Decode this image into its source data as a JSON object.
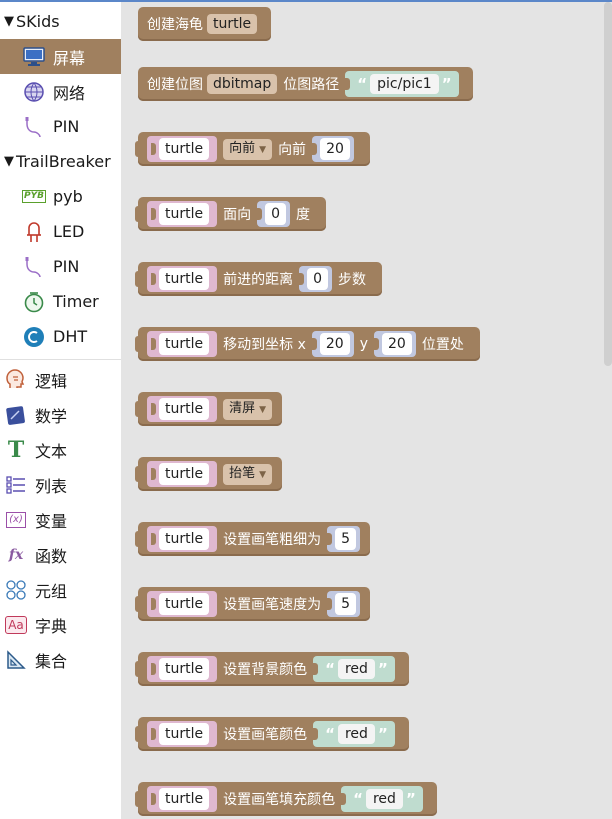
{
  "sidebar": {
    "groups": [
      {
        "label": "SKids",
        "items": [
          {
            "label": "屏幕",
            "icon": "monitor-icon",
            "selected": true
          },
          {
            "label": "网络",
            "icon": "network-icon"
          },
          {
            "label": "PIN",
            "icon": "pin-cable-icon"
          }
        ]
      },
      {
        "label": "TrailBreaker",
        "items": [
          {
            "label": "pyb",
            "icon": "pyb-icon",
            "icon_text": "PYB"
          },
          {
            "label": "LED",
            "icon": "led-icon"
          },
          {
            "label": "PIN",
            "icon": "pin-cable-icon"
          },
          {
            "label": "Timer",
            "icon": "clock-icon"
          },
          {
            "label": "DHT",
            "icon": "dht-icon"
          }
        ]
      }
    ],
    "categories": [
      {
        "label": "逻辑",
        "icon": "logic-head-icon"
      },
      {
        "label": "数学",
        "icon": "math-icon"
      },
      {
        "label": "文本",
        "icon": "text-icon",
        "icon_text": "T"
      },
      {
        "label": "列表",
        "icon": "list-icon"
      },
      {
        "label": "变量",
        "icon": "variable-icon",
        "icon_text": "(x)"
      },
      {
        "label": "函数",
        "icon": "function-icon",
        "icon_text": "fx"
      },
      {
        "label": "元组",
        "icon": "tuple-icon"
      },
      {
        "label": "字典",
        "icon": "dictionary-icon",
        "icon_text": "Aa"
      },
      {
        "label": "集合",
        "icon": "set-icon"
      }
    ]
  },
  "blocks": {
    "create_turtle": {
      "label": "创建海龟",
      "name": "turtle"
    },
    "create_bitmap": {
      "label": "创建位图",
      "name": "dbitmap",
      "path_label": "位图路径",
      "path_value": "pic/pic1"
    },
    "forward": {
      "obj": "turtle",
      "dropdown": "向前",
      "label": "向前",
      "value": "20"
    },
    "heading": {
      "obj": "turtle",
      "label": "面向",
      "value": "0",
      "suffix": "度"
    },
    "distance": {
      "obj": "turtle",
      "label": "前进的距离",
      "value": "0",
      "suffix": "步数"
    },
    "goto": {
      "obj": "turtle",
      "label": "移动到坐标 x",
      "x": "20",
      "y_label": "y",
      "y": "20",
      "suffix": "位置处"
    },
    "clear": {
      "obj": "turtle",
      "dropdown": "清屏"
    },
    "penup": {
      "obj": "turtle",
      "dropdown": "抬笔"
    },
    "pensize": {
      "obj": "turtle",
      "label": "设置画笔粗细为",
      "value": "5"
    },
    "speed": {
      "obj": "turtle",
      "label": "设置画笔速度为",
      "value": "5"
    },
    "bgcolor": {
      "obj": "turtle",
      "label": "设置背景颜色",
      "value": "red"
    },
    "pencolor": {
      "obj": "turtle",
      "label": "设置画笔颜色",
      "value": "red"
    },
    "fillcolor": {
      "obj": "turtle",
      "label": "设置画笔填充颜色",
      "value": "red"
    }
  },
  "colors": {
    "block": "#a0805f",
    "selected": "#a0805f",
    "workspace": "#e4e4e4"
  }
}
